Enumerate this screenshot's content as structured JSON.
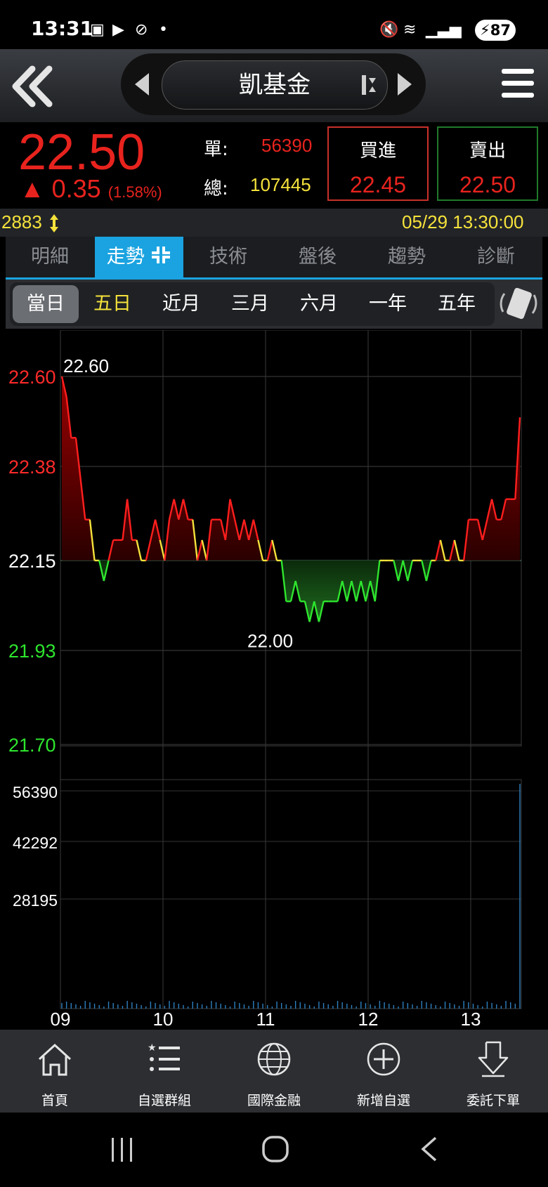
{
  "status_bar": {
    "time": "13:31",
    "battery": "87"
  },
  "header": {
    "title": "凱基金"
  },
  "quote": {
    "price": "22.50",
    "change": "▲ 0.35",
    "change_pct": "(1.58%)",
    "single_label": "單:",
    "single_value": "56390",
    "total_label": "總:",
    "total_value": "107445",
    "buy_label": "買進",
    "buy_price": "22.45",
    "sell_label": "賣出",
    "sell_price": "22.50"
  },
  "info_bar": {
    "code": "2883",
    "datetime": "05/29 13:30:00"
  },
  "tabs": [
    {
      "label": "明細"
    },
    {
      "label": "走勢"
    },
    {
      "label": "技術"
    },
    {
      "label": "盤後"
    },
    {
      "label": "趨勢"
    },
    {
      "label": "診斷"
    }
  ],
  "periods": [
    {
      "label": "當日"
    },
    {
      "label": "五日"
    },
    {
      "label": "近月"
    },
    {
      "label": "三月"
    },
    {
      "label": "六月"
    },
    {
      "label": "一年"
    },
    {
      "label": "五年"
    }
  ],
  "chart_data": {
    "type": "line",
    "x_ticks": [
      "09",
      "10",
      "11",
      "12",
      "13"
    ],
    "y_ticks": [
      "22.60",
      "22.38",
      "22.15",
      "21.93",
      "21.70"
    ],
    "ylim": [
      21.7,
      22.6
    ],
    "reference": 22.15,
    "max_label": "22.60",
    "min_label": "22.00",
    "volume_ticks": [
      "56390",
      "42292",
      "28195"
    ],
    "colors": {
      "up": "#ff1e1e",
      "down": "#2ee52e",
      "flat": "#f5e23b"
    },
    "series": [
      {
        "values": [
          22.6,
          22.55,
          22.45,
          22.45,
          22.35,
          22.25,
          22.25,
          22.15,
          22.15,
          22.1,
          22.15,
          22.2,
          22.2,
          22.2,
          22.3,
          22.2,
          22.2,
          22.15,
          22.15,
          22.2,
          22.25,
          22.2,
          22.15,
          22.25,
          22.3,
          22.25,
          22.3,
          22.25,
          22.25,
          22.15,
          22.2,
          22.15,
          22.25,
          22.25,
          22.25,
          22.2,
          22.3,
          22.25,
          22.2,
          22.25,
          22.2,
          22.25,
          22.2,
          22.15,
          22.15,
          22.2,
          22.15,
          22.15,
          22.05,
          22.05,
          22.1,
          22.05,
          22.05,
          22.0,
          22.05,
          22.0,
          22.05,
          22.05,
          22.05,
          22.05,
          22.1,
          22.05,
          22.1,
          22.05,
          22.1,
          22.05,
          22.1,
          22.05,
          22.15,
          22.15,
          22.15,
          22.15,
          22.1,
          22.15,
          22.1,
          22.15,
          22.15,
          22.15,
          22.1,
          22.15,
          22.15,
          22.2,
          22.15,
          22.15,
          22.2,
          22.15,
          22.15,
          22.25,
          22.25,
          22.25,
          22.2,
          22.25,
          22.3,
          22.25,
          22.25,
          22.3,
          22.3,
          22.3,
          22.5
        ]
      }
    ]
  },
  "nav": [
    {
      "label": "首頁",
      "icon": "home-icon"
    },
    {
      "label": "自選群組",
      "icon": "list-icon"
    },
    {
      "label": "國際金融",
      "icon": "globe-icon"
    },
    {
      "label": "新增自選",
      "icon": "plus-circle-icon"
    },
    {
      "label": "委託下單",
      "icon": "order-arrow-icon"
    }
  ]
}
